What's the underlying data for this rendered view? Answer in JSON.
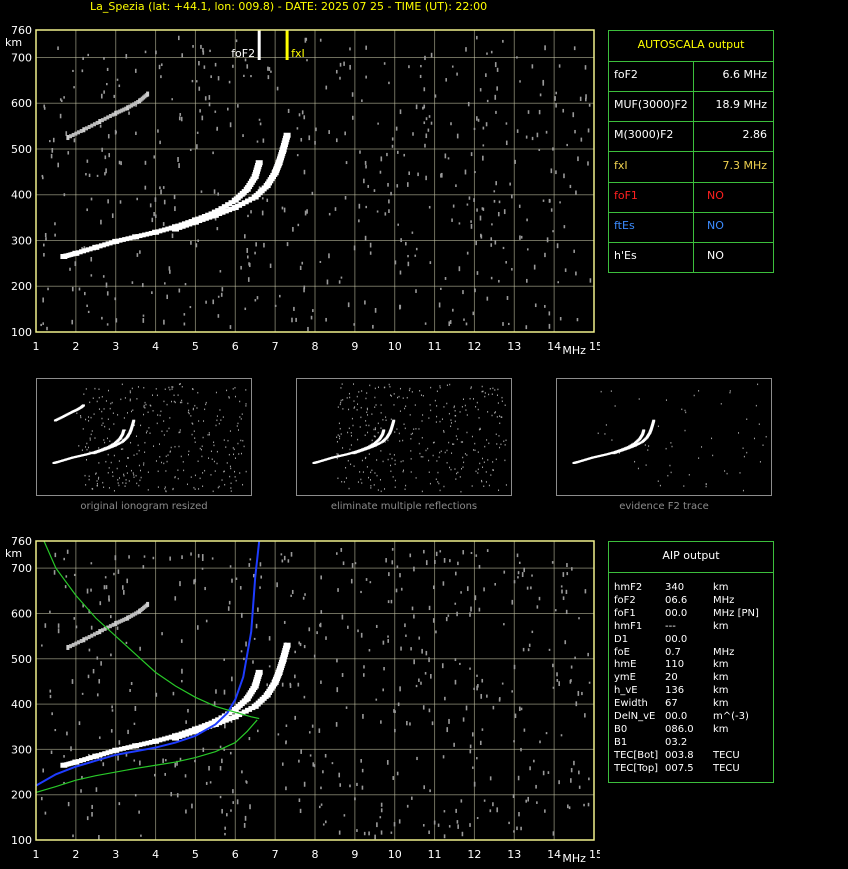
{
  "header": {
    "title": "La_Spezia (lat: +44.1, lon: 009.8) - DATE: 2025 07 25 - TIME (UT): 22:00"
  },
  "colors": {
    "background": "#000000",
    "grid": "#c8c8aa",
    "frame": "#f0f08c",
    "panel_border": "#3cbe3c",
    "title": "#ffff00",
    "trace": "#ffffff",
    "noise": "#9a9a9a",
    "fxi_marker": "#ffff00",
    "foF2_marker": "#ffffff",
    "profile_blue": "#1e3cff",
    "profile_green": "#28c828",
    "no_red": "#ff2020",
    "no_blue": "#3c8cff"
  },
  "chart_data": [
    {
      "type": "scatter",
      "id": "ionogram-main",
      "x_axis": {
        "range": [
          1,
          15
        ],
        "ticks": [
          "1",
          "2",
          "3",
          "4",
          "5",
          "6",
          "7",
          "8",
          "9",
          "10",
          "11",
          "12",
          "13",
          "14",
          "15"
        ],
        "unit": "MHz"
      },
      "y_axis": {
        "range": [
          100,
          760
        ],
        "ticks": [
          "100",
          "200",
          "300",
          "400",
          "500",
          "600",
          "700",
          "760"
        ],
        "unit": "km"
      },
      "grid": true,
      "markers": [
        {
          "label": "foF2",
          "freq": 6.6
        },
        {
          "label": "fxI",
          "freq": 7.3
        }
      ],
      "series": [
        {
          "name": "O-trace",
          "x": [
            1.7,
            2.0,
            2.5,
            3.0,
            3.5,
            4.0,
            4.5,
            5.0,
            5.5,
            6.0,
            6.3,
            6.5,
            6.6
          ],
          "y": [
            265,
            272,
            285,
            298,
            308,
            318,
            330,
            345,
            362,
            388,
            412,
            440,
            470
          ]
        },
        {
          "name": "X-trace",
          "x": [
            4.5,
            5.0,
            5.5,
            6.0,
            6.5,
            6.8,
            7.0,
            7.1,
            7.2,
            7.3
          ],
          "y": [
            325,
            340,
            355,
            372,
            395,
            420,
            448,
            470,
            498,
            530
          ]
        },
        {
          "name": "second-hop",
          "x": [
            1.8,
            2.2,
            2.6,
            3.0,
            3.3,
            3.6,
            3.8
          ],
          "y": [
            525,
            542,
            560,
            578,
            590,
            605,
            620
          ]
        }
      ]
    },
    {
      "type": "line",
      "id": "ionogram-aip",
      "x_axis": {
        "range": [
          1,
          15
        ],
        "ticks": [
          "1",
          "2",
          "3",
          "4",
          "5",
          "6",
          "7",
          "8",
          "9",
          "10",
          "11",
          "12",
          "13",
          "14",
          "15"
        ],
        "unit": "MHz"
      },
      "y_axis": {
        "range": [
          100,
          760
        ],
        "ticks": [
          "100",
          "200",
          "300",
          "400",
          "500",
          "600",
          "700",
          "760"
        ],
        "unit": "km"
      },
      "grid": true,
      "series": [
        {
          "name": "blue-profile",
          "x": [
            1.0,
            1.5,
            2.0,
            2.5,
            3.0,
            3.5,
            4.0,
            4.5,
            5.0,
            5.5,
            5.8,
            6.0,
            6.2,
            6.4,
            6.5,
            6.6
          ],
          "y": [
            220,
            245,
            262,
            275,
            288,
            296,
            304,
            315,
            330,
            355,
            380,
            410,
            460,
            560,
            680,
            760
          ]
        },
        {
          "name": "green-profile-upper",
          "x": [
            1.2,
            1.5,
            2.0,
            2.5,
            3.0,
            3.5,
            4.0,
            4.5,
            5.0,
            5.5,
            6.0,
            6.4,
            6.6
          ],
          "y": [
            760,
            700,
            640,
            590,
            550,
            510,
            470,
            440,
            415,
            395,
            382,
            372,
            368
          ]
        },
        {
          "name": "green-profile-lower",
          "x": [
            1.0,
            1.5,
            2.0,
            2.5,
            3.0,
            3.5,
            4.0,
            4.5,
            5.0,
            5.5,
            6.0,
            6.3,
            6.55
          ],
          "y": [
            205,
            218,
            232,
            242,
            250,
            258,
            265,
            272,
            282,
            295,
            315,
            340,
            365
          ]
        }
      ]
    }
  ],
  "autoscala": {
    "title": "AUTOSCALA output",
    "rows": [
      {
        "label": "foF2",
        "value": "6.6 MHz",
        "color": "#ffffff"
      },
      {
        "label": "MUF(3000)F2",
        "value": "18.9 MHz",
        "color": "#ffffff"
      },
      {
        "label": "M(3000)F2",
        "value": "2.86",
        "color": "#ffffff"
      },
      {
        "label": "fxI",
        "value": "7.3 MHz",
        "color": "#f0d250"
      },
      {
        "label": "foF1",
        "value": "NO",
        "color": "#ff2020"
      },
      {
        "label": "ftEs",
        "value": "NO",
        "color": "#3c8cff"
      },
      {
        "label": "h'Es",
        "value": "NO",
        "color": "#ffffff"
      }
    ]
  },
  "thumbnails": [
    {
      "caption": "original ionogram resized"
    },
    {
      "caption": "eliminate multiple reflections"
    },
    {
      "caption": "evidence F2 trace"
    }
  ],
  "aip": {
    "title": "AIP output",
    "rows": [
      {
        "param": "hmF2",
        "value": "340",
        "unit": "km"
      },
      {
        "param": "foF2",
        "value": "06.6",
        "unit": "MHz"
      },
      {
        "param": "foF1",
        "value": "00.0",
        "unit": "MHz   [PN]"
      },
      {
        "param": "hmF1",
        "value": "---",
        "unit": "km"
      },
      {
        "param": "D1",
        "value": "00.0",
        "unit": ""
      },
      {
        "param": "foE",
        "value": "0.7",
        "unit": "MHz"
      },
      {
        "param": "hmE",
        "value": "110",
        "unit": "km"
      },
      {
        "param": "ymE",
        "value": "20",
        "unit": "km"
      },
      {
        "param": "h_vE",
        "value": "136",
        "unit": "km"
      },
      {
        "param": "Ewidth",
        "value": "67",
        "unit": "km"
      },
      {
        "param": "DelN_vE",
        "value": "00.0",
        "unit": "m^(-3)"
      },
      {
        "param": "B0",
        "value": "086.0",
        "unit": "km"
      },
      {
        "param": "B1",
        "value": "03.2",
        "unit": ""
      },
      {
        "param": "TEC[Bot]",
        "value": "003.8",
        "unit": "TECU"
      },
      {
        "param": "TEC[Top]",
        "value": "007.5",
        "unit": "TECU"
      }
    ]
  }
}
